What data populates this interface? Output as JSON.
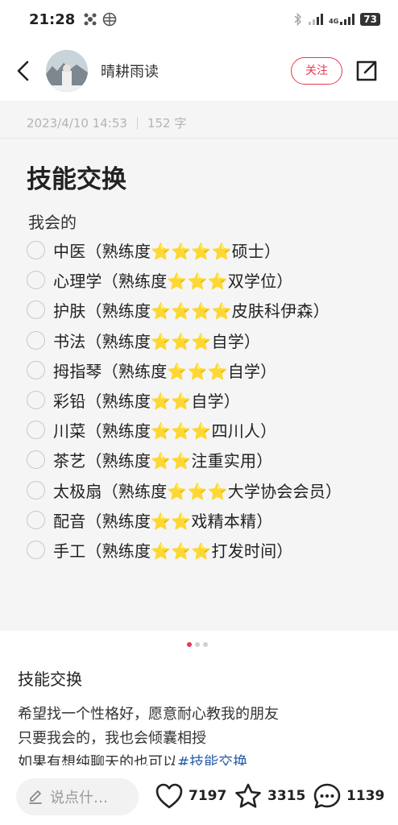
{
  "status_bar": {
    "time": "21:28",
    "network": "4G",
    "battery": "73"
  },
  "header": {
    "author_name": "晴耕雨读",
    "follow_label": "关注"
  },
  "note": {
    "date": "2023/4/10 14:53",
    "word_count": "152 字",
    "card_title": "技能交换",
    "section_label": "我会的",
    "skills": [
      {
        "text": "中医（熟练度⭐⭐⭐⭐硕士）"
      },
      {
        "text": "心理学（熟练度⭐⭐⭐双学位）"
      },
      {
        "text": "护肤（熟练度⭐⭐⭐⭐皮肤科伊森）"
      },
      {
        "text": "书法（熟练度⭐⭐⭐自学）"
      },
      {
        "text": "拇指琴（熟练度⭐⭐⭐自学）"
      },
      {
        "text": "彩铅（熟练度⭐⭐自学）"
      },
      {
        "text": "川菜（熟练度⭐⭐⭐四川人）"
      },
      {
        "text": "茶艺（熟练度⭐⭐注重实用）"
      },
      {
        "text": "太极扇（熟练度⭐⭐⭐大学协会会员）"
      },
      {
        "text": "配音（熟练度⭐⭐戏精本精）"
      },
      {
        "text": "手工（熟练度⭐⭐⭐打发时间）"
      }
    ],
    "pager": {
      "total": 3,
      "active": 1
    }
  },
  "post": {
    "title": "技能交换",
    "line1": "希望找一个性格好，愿意耐心教我的朋友",
    "line2": "只要我会的，我也会倾囊相授",
    "line3_text": "如果有想纯聊天的也可以",
    "line3_tag": "#技能交换"
  },
  "bottom_bar": {
    "comment_placeholder": "说点什…",
    "likes": "7197",
    "collects": "3315",
    "comments": "1139"
  },
  "colors": {
    "accent": "#e8384f",
    "tag": "#2a5fa8",
    "card_bg": "#f5f5f5"
  }
}
